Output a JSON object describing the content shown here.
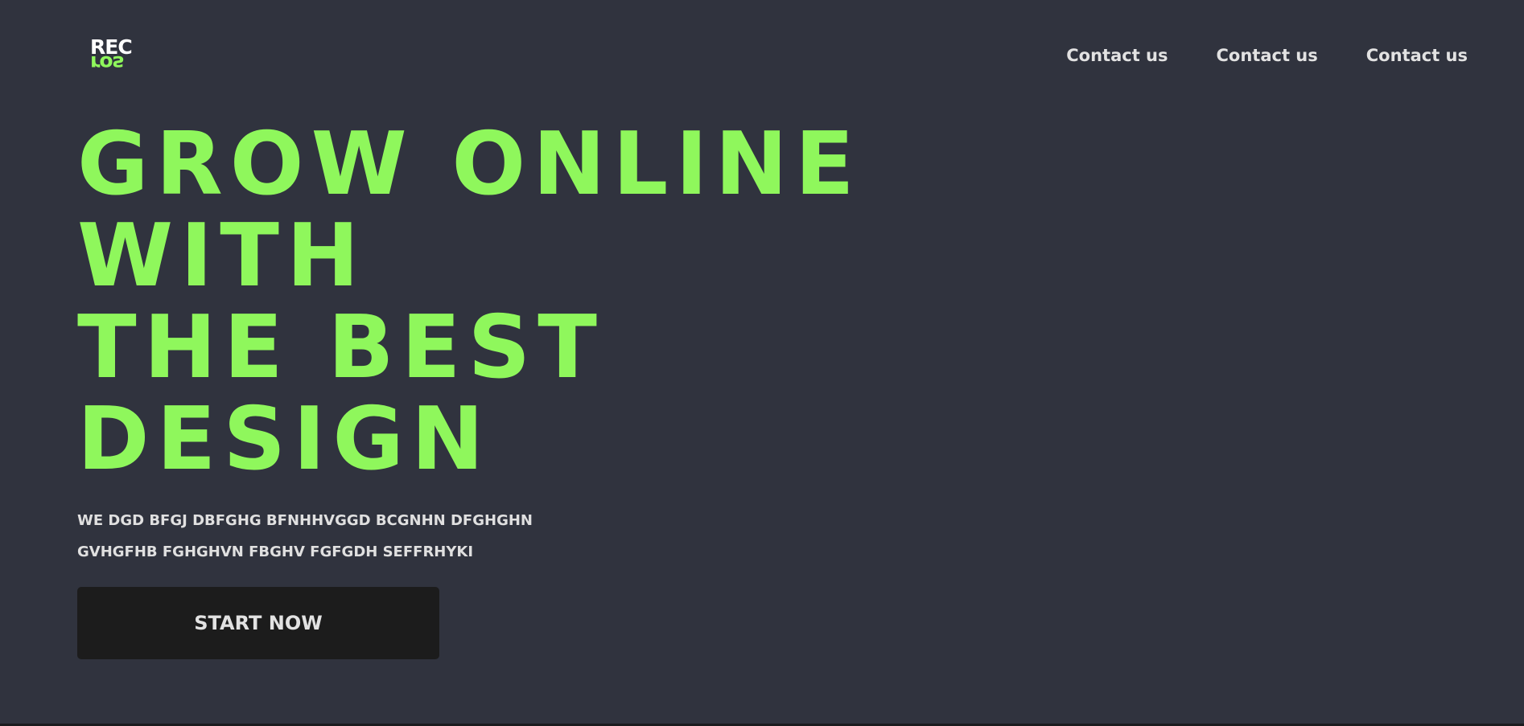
{
  "brand": {
    "logo_top": "REC",
    "logo_bottom": "ros"
  },
  "nav": {
    "items": [
      {
        "label": "Contact us"
      },
      {
        "label": "Contact us"
      },
      {
        "label": "Contact us"
      }
    ]
  },
  "hero": {
    "title_lines": [
      "GROW ONLINE",
      "WITH",
      "THE BEST",
      "DESIGN"
    ],
    "subtitle_lines": [
      "WE DGD BFGJ DBFGHG BFNHHVGGD BCGNHN DFGHGHN",
      "GVHGFHB FGHGHVN FBGHV FGFGDH SEFFRHYKI"
    ],
    "cta_label": "START NOW"
  },
  "colors": {
    "background": "#30333e",
    "accent": "#8ff75c",
    "button": "#1c1c1c",
    "text": "#e2e2e2"
  }
}
